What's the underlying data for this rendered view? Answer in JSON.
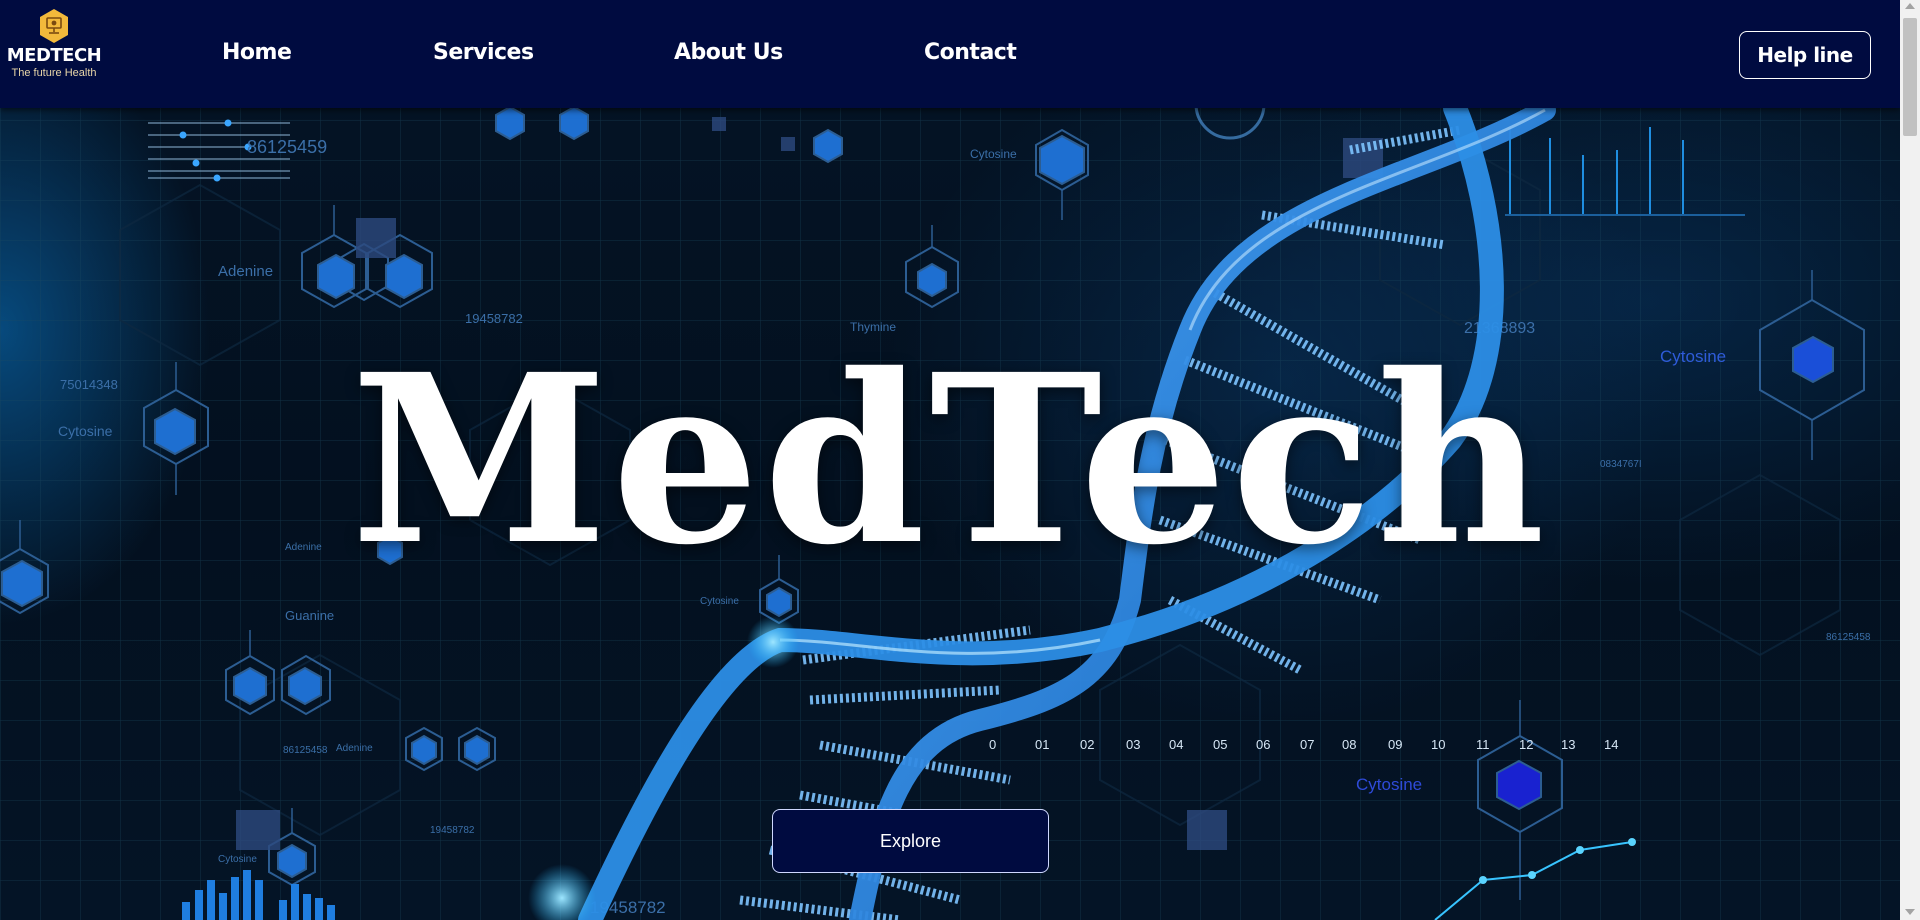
{
  "brand": {
    "name": "MEDTECH",
    "tagline": "The future Health",
    "icon": "hexagon-monitor-icon"
  },
  "nav": {
    "items": [
      {
        "label": "Home"
      },
      {
        "label": "Services"
      },
      {
        "label": "About Us"
      },
      {
        "label": "Contact"
      }
    ],
    "helpline_label": "Help line"
  },
  "hero": {
    "title": "MedTech",
    "explore_label": "Explore",
    "axis_ticks": [
      "0",
      "01",
      "02",
      "03",
      "04",
      "05",
      "06",
      "07",
      "08",
      "09",
      "10",
      "11",
      "12",
      "13",
      "14"
    ],
    "background_labels": {
      "adenine": "Adenine",
      "cytosine": "Cytosine",
      "thymine": "Thymine",
      "guanine": "Guanine",
      "codes": [
        "86125459",
        "19458782",
        "75014348",
        "21368893",
        "86125458",
        "0834767I"
      ]
    }
  },
  "colors": {
    "navbar": "#000b40",
    "accent_blue": "#1f7ee0",
    "background": "#041426",
    "logo_gold": "#f2b93b"
  }
}
